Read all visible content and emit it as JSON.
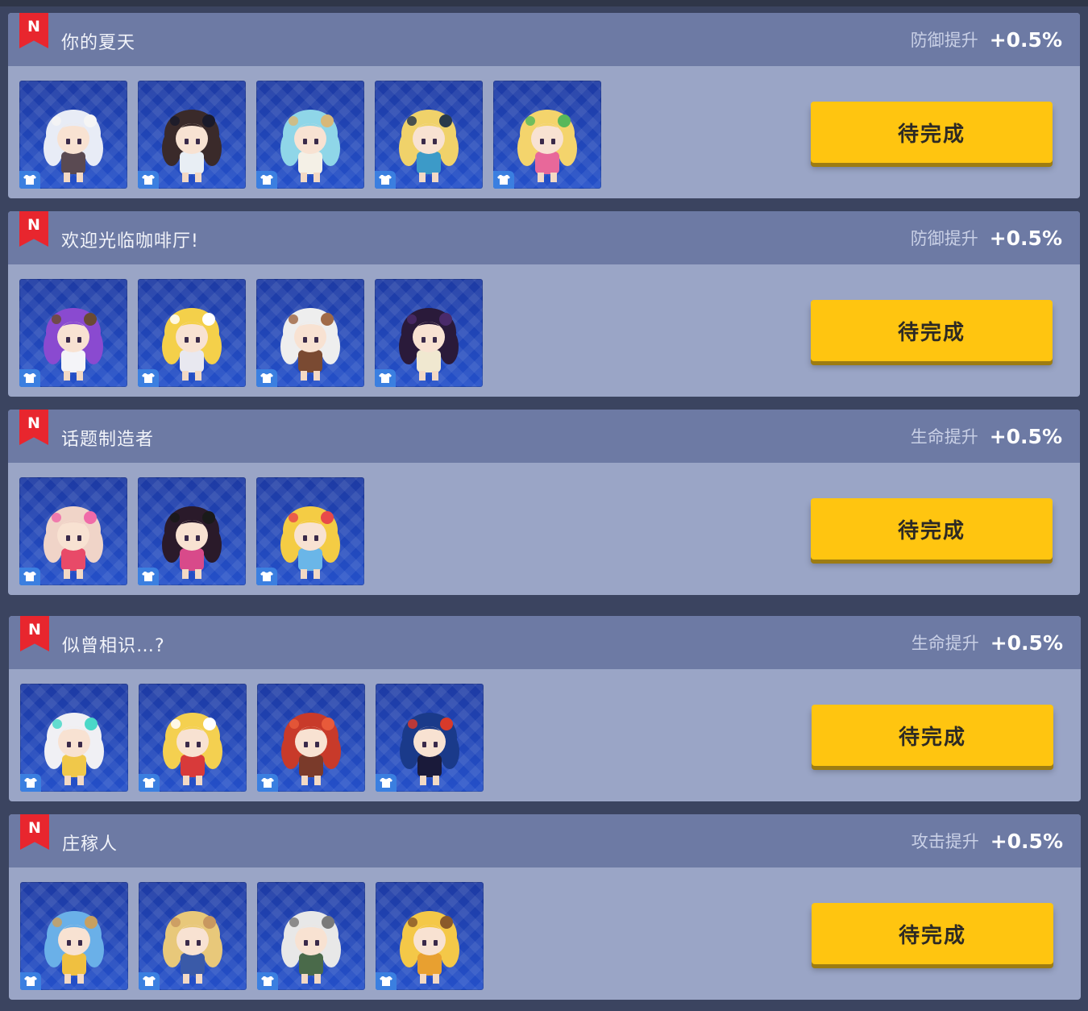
{
  "sets": [
    {
      "badge": "N",
      "title": "你的夏天",
      "bonus_label": "防御提升",
      "bonus_value": "+0.5%",
      "action_label": "待完成",
      "costumes": [
        {
          "icon": "white-twintail-swimsuit-character-icon",
          "hair": "#e8ecf6",
          "body": "#5a4a52",
          "accent": "#f5f5f5"
        },
        {
          "icon": "orca-float-character-icon",
          "hair": "#3a2a2a",
          "body": "#e8eef4",
          "accent": "#1a1a2a"
        },
        {
          "icon": "straw-hat-seagull-character-icon",
          "hair": "#8fd6e8",
          "body": "#f4f0e6",
          "accent": "#d8b878"
        },
        {
          "icon": "goggles-diver-character-icon",
          "hair": "#f0d26a",
          "body": "#3c9ac8",
          "accent": "#2a3a4a"
        },
        {
          "icon": "flower-blonde-character-icon",
          "hair": "#f4d46c",
          "body": "#e8689a",
          "accent": "#58b85a"
        }
      ]
    },
    {
      "badge": "N",
      "title": "欢迎光临咖啡厅!",
      "bonus_label": "防御提升",
      "bonus_value": "+0.5%",
      "action_label": "待完成",
      "costumes": [
        {
          "icon": "coffee-cup-purple-hair-character-icon",
          "hair": "#8a4ad0",
          "body": "#f4f4f8",
          "accent": "#6a4a32"
        },
        {
          "icon": "bunny-ears-maid-character-icon",
          "hair": "#f4d04a",
          "body": "#e8e8f0",
          "accent": "#ffffff"
        },
        {
          "icon": "wolf-ears-cowboy-character-icon",
          "hair": "#eeeeee",
          "body": "#7a4a32",
          "accent": "#a06a48"
        },
        {
          "icon": "tentacle-dark-character-icon",
          "hair": "#2a1a3a",
          "body": "#f0e8d0",
          "accent": "#4a2a6a"
        }
      ]
    },
    {
      "badge": "N",
      "title": "话题制造者",
      "bonus_label": "生命提升",
      "bonus_value": "+0.5%",
      "action_label": "待完成",
      "costumes": [
        {
          "icon": "pink-bow-fox-character-icon",
          "hair": "#f0d4c8",
          "body": "#e84a68",
          "accent": "#f06aa8"
        },
        {
          "icon": "camera-witch-hat-character-icon",
          "hair": "#2a1a2a",
          "body": "#d84a8a",
          "accent": "#1a1a1a"
        },
        {
          "icon": "rainbow-headband-camera-character-icon",
          "hair": "#f4cc44",
          "body": "#6ab6e8",
          "accent": "#e84a4a"
        }
      ]
    },
    {
      "badge": "N",
      "title": "似曾相识…?",
      "bonus_label": "生命提升",
      "bonus_value": "+0.5%",
      "action_label": "待完成",
      "costumes": [
        {
          "icon": "white-hair-headphones-character-icon",
          "hair": "#f0f0f4",
          "body": "#f0c84a",
          "accent": "#4ad8c8"
        },
        {
          "icon": "angel-sword-character-icon",
          "hair": "#f4d050",
          "body": "#d83a3a",
          "accent": "#ffffff"
        },
        {
          "icon": "red-demon-character-icon",
          "hair": "#c83a2a",
          "body": "#7a3a2a",
          "accent": "#e85a3a"
        },
        {
          "icon": "dark-wings-character-icon",
          "hair": "#1a3a8a",
          "body": "#1a1a3a",
          "accent": "#d83a2a"
        }
      ]
    },
    {
      "badge": "N",
      "title": "庄稼人",
      "bonus_label": "攻击提升",
      "bonus_value": "+0.5%",
      "action_label": "待完成",
      "costumes": [
        {
          "icon": "apple-basket-farmer-character-icon",
          "hair": "#6ab0e8",
          "body": "#f0c040",
          "accent": "#c8a060"
        },
        {
          "icon": "straw-hat-farmer-character-icon",
          "hair": "#e8c87a",
          "body": "#3a5aa8",
          "accent": "#c89860"
        },
        {
          "icon": "old-farmer-bucket-hat-character-icon",
          "hair": "#e8e8e8",
          "body": "#4a6a4a",
          "accent": "#7a7a7a"
        },
        {
          "icon": "scarecrow-character-icon",
          "hair": "#f4c848",
          "body": "#e8a030",
          "accent": "#8a5a2a"
        }
      ]
    }
  ]
}
